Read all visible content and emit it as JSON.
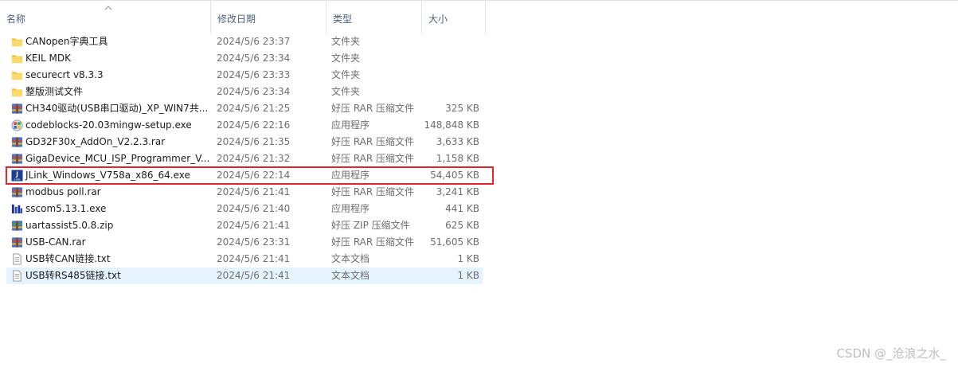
{
  "header": {
    "name": "名称",
    "date_modified": "修改日期",
    "type": "类型",
    "size": "大小"
  },
  "files": [
    {
      "name": "CANopen字典工具",
      "date": "2024/5/6 23:37",
      "type": "文件夹",
      "size": "",
      "icon": "folder-icon"
    },
    {
      "name": "KEIL MDK",
      "date": "2024/5/6 23:34",
      "type": "文件夹",
      "size": "",
      "icon": "folder-icon"
    },
    {
      "name": "securecrt v8.3.3",
      "date": "2024/5/6 23:33",
      "type": "文件夹",
      "size": "",
      "icon": "folder-icon"
    },
    {
      "name": "整版测试文件",
      "date": "2024/5/6 23:34",
      "type": "文件夹",
      "size": "",
      "icon": "folder-icon"
    },
    {
      "name": "CH340驱动(USB串口驱动)_XP_WIN7共...",
      "date": "2024/5/6 21:25",
      "type": "好压 RAR 压缩文件",
      "size": "325 KB",
      "icon": "rar-archive-icon"
    },
    {
      "name": "codeblocks-20.03mingw-setup.exe",
      "date": "2024/5/6 22:16",
      "type": "应用程序",
      "size": "148,848 KB",
      "icon": "codeblocks-app-icon"
    },
    {
      "name": "GD32F30x_AddOn_V2.2.3.rar",
      "date": "2024/5/6 21:35",
      "type": "好压 RAR 压缩文件",
      "size": "3,633 KB",
      "icon": "rar-archive-icon"
    },
    {
      "name": "GigaDevice_MCU_ISP_Programmer_V...",
      "date": "2024/5/6 21:32",
      "type": "好压 RAR 压缩文件",
      "size": "1,158 KB",
      "icon": "rar-archive-icon"
    },
    {
      "name": "JLink_Windows_V758a_x86_64.exe",
      "date": "2024/5/6 22:14",
      "type": "应用程序",
      "size": "54,405 KB",
      "icon": "jlink-app-icon"
    },
    {
      "name": "modbus poll.rar",
      "date": "2024/5/6 21:41",
      "type": "好压 RAR 压缩文件",
      "size": "3,241 KB",
      "icon": "rar-archive-icon"
    },
    {
      "name": "sscom5.13.1.exe",
      "date": "2024/5/6 21:40",
      "type": "应用程序",
      "size": "441 KB",
      "icon": "sscom-app-icon"
    },
    {
      "name": "uartassist5.0.8.zip",
      "date": "2024/5/6 21:41",
      "type": "好压 ZIP 压缩文件",
      "size": "625 KB",
      "icon": "zip-archive-icon"
    },
    {
      "name": "USB-CAN.rar",
      "date": "2024/5/6 23:31",
      "type": "好压 RAR 压缩文件",
      "size": "51,605 KB",
      "icon": "rar-archive-icon"
    },
    {
      "name": "USB转CAN链接.txt",
      "date": "2024/5/6 21:41",
      "type": "文本文档",
      "size": "1 KB",
      "icon": "text-file-icon"
    },
    {
      "name": "USB转RS485链接.txt",
      "date": "2024/5/6 21:41",
      "type": "文本文档",
      "size": "1 KB",
      "icon": "text-file-icon"
    }
  ],
  "selected_index": 14,
  "highlighted_index": 8,
  "watermark": "CSDN @_沧浪之水_",
  "colors": {
    "header_text": "#4c607a",
    "selection_bg": "#e5f3ff",
    "highlight_border": "#e0262a",
    "folder": "#f6c84c"
  }
}
